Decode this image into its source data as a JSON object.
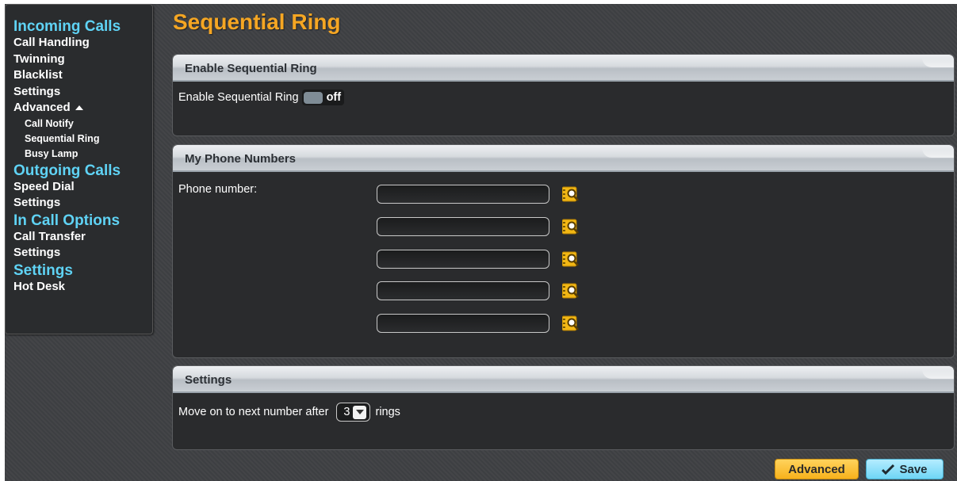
{
  "sidebar": {
    "incoming_heading": "Incoming Calls",
    "incoming_items": [
      "Call Handling",
      "Twinning",
      "Blacklist",
      "Settings"
    ],
    "advanced_label": "Advanced",
    "advanced_items": [
      "Call Notify",
      "Sequential Ring",
      "Busy Lamp"
    ],
    "outgoing_heading": "Outgoing Calls",
    "outgoing_items": [
      "Speed Dial",
      "Settings"
    ],
    "incall_heading": "In Call Options",
    "incall_items": [
      "Call Transfer",
      "Settings"
    ],
    "settings_heading": "Settings",
    "settings_items": [
      "Hot Desk"
    ]
  },
  "page": {
    "title": "Sequential Ring"
  },
  "enable_panel": {
    "title": "Enable Sequential Ring",
    "label": "Enable Sequential Ring",
    "toggle_state": "off"
  },
  "numbers_panel": {
    "title": "My Phone Numbers",
    "label": "Phone number:",
    "numbers": [
      "",
      "",
      "",
      "",
      ""
    ]
  },
  "settings_panel": {
    "title": "Settings",
    "prefix": "Move on to next number after",
    "rings_value": "3",
    "suffix": "rings"
  },
  "buttons": {
    "advanced": "Advanced",
    "save": "Save"
  },
  "colors": {
    "accent_orange": "#f5a623",
    "accent_cyan": "#5fd3f5",
    "background": "#3f4144"
  }
}
